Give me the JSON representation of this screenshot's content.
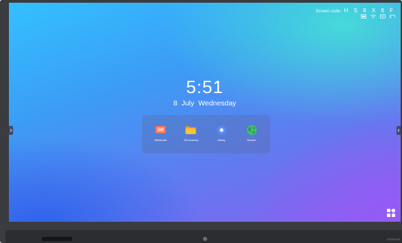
{
  "status": {
    "screen_code_label": "Screen code :",
    "screen_code_value": "H S 8 X 8 F",
    "icons": [
      "media-icon",
      "wifi-icon",
      "screen-share-icon",
      "cast-icon"
    ]
  },
  "home": {
    "time": "5:51",
    "date": "8 July  Wednesday"
  },
  "apps": [
    {
      "label": "Whiteboard",
      "icon": "whiteboard-icon",
      "color": "#f0705a"
    },
    {
      "label": "File browsing",
      "icon": "folder-icon",
      "color": "#ffb020"
    },
    {
      "label": "Setting",
      "icon": "gear-icon",
      "color": "#5a8cf5"
    },
    {
      "label": "Browser",
      "icon": "globe-icon",
      "color": "#3fbf6a"
    }
  ],
  "bezel": {
    "brand": "SONSUN"
  }
}
